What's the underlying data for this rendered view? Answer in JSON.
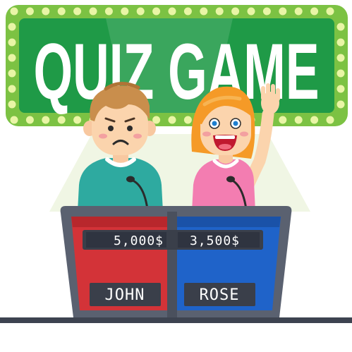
{
  "sign": {
    "title": "QUIZ GAME",
    "bulb_color": "#e9f5a6",
    "frame_color": "#7cc243",
    "panel_color": "#1f9a47"
  },
  "players": [
    {
      "name": "JOHN",
      "score": "5,000$",
      "expression": "sad",
      "podium_color": "#d33338",
      "shirt_color": "#2eaaa0",
      "hair_color": "#c98e4c"
    },
    {
      "name": "ROSE",
      "score": "3,500$",
      "expression": "excited",
      "podium_color": "#1f63c9",
      "shirt_color": "#f37db1",
      "hair_color": "#f59a27"
    }
  ]
}
